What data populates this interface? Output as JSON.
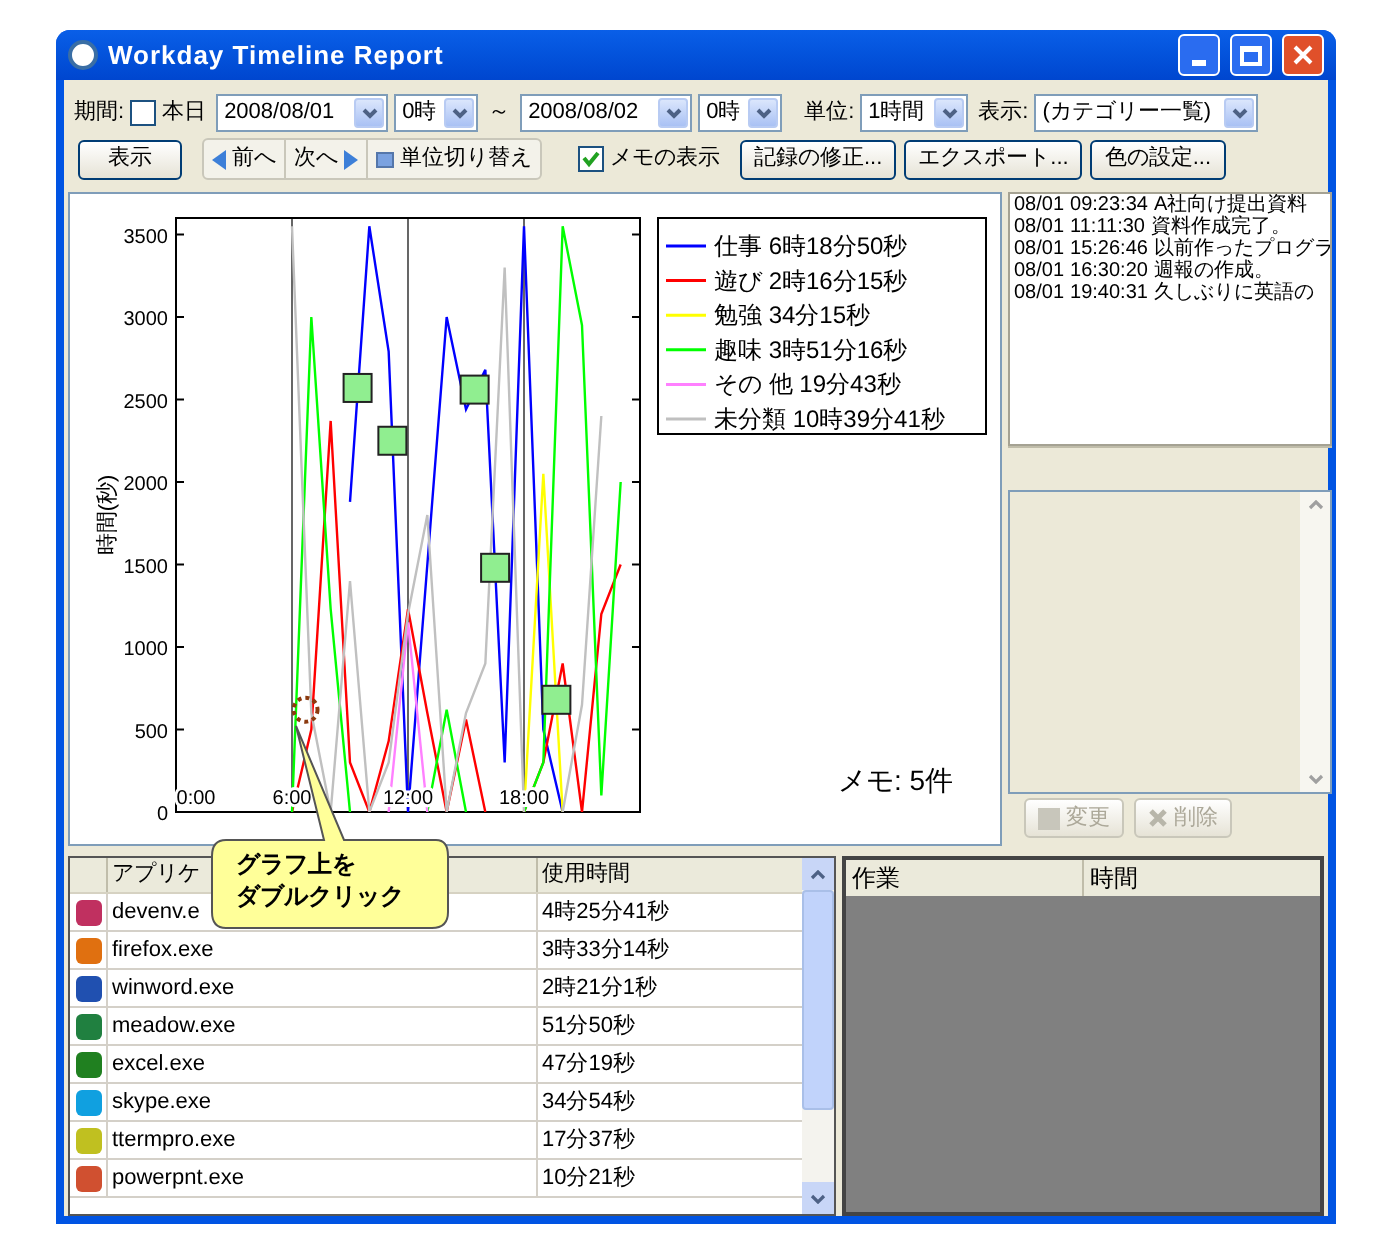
{
  "window": {
    "title": "Workday Timeline Report"
  },
  "toolbar": {
    "period_label": "期間:",
    "today": {
      "label": "本日",
      "checked": false
    },
    "start_date": "2008/08/01",
    "start_hour": "0時",
    "range_sep": "～",
    "end_date": "2008/08/02",
    "end_hour": "0時",
    "unit_label": "単位:",
    "unit": "1時間",
    "view_label": "表示:",
    "view": "(カテゴリー一覧)"
  },
  "actions": {
    "show": "表示",
    "prev": "前へ",
    "next": "次へ",
    "switch_unit": "単位切り替え",
    "memo_toggle": {
      "label": "メモの表示",
      "checked": true
    },
    "buttons": [
      "記録の修正...",
      "エクスポート...",
      "色の設定..."
    ]
  },
  "chart": {
    "memo_count": "メモ: 5件",
    "callout": [
      "グラフ上を",
      "ダブルクリック"
    ],
    "chart_data": {
      "type": "line",
      "ylabel": "時間(秒)",
      "grid": "x",
      "legend": true,
      "x": [
        6,
        7,
        8,
        9,
        10,
        11,
        12,
        13,
        14,
        15,
        16,
        17,
        18,
        19,
        20,
        21,
        22,
        23
      ],
      "xlim": [
        0,
        24
      ],
      "ylim": [
        0,
        3600
      ],
      "xticks": [
        {
          "value": 0,
          "label": "0:00"
        },
        {
          "value": 6,
          "label": "6:00"
        },
        {
          "value": 12,
          "label": "12:00"
        },
        {
          "value": 18,
          "label": "18:00"
        }
      ],
      "yticks": [
        0,
        500,
        1000,
        1500,
        2000,
        2500,
        3000,
        3500
      ],
      "series": [
        {
          "name": "仕事 6時18分50秒",
          "color": "#0000ff",
          "values": [
            null,
            null,
            null,
            1880,
            3550,
            2790,
            0,
            1500,
            3000,
            2440,
            2680,
            300,
            3550,
            500,
            0,
            null,
            null,
            null
          ]
        },
        {
          "name": "遊び 2時16分15秒",
          "color": "#ff0000",
          "values": [
            0,
            500,
            2370,
            300,
            0,
            430,
            1230,
            600,
            0,
            560,
            0,
            null,
            0,
            300,
            900,
            0,
            1200,
            1500
          ]
        },
        {
          "name": "勉強 34分15秒",
          "color": "#ffff00",
          "values": [
            null,
            null,
            null,
            null,
            null,
            null,
            null,
            null,
            null,
            null,
            null,
            null,
            0,
            2050,
            0,
            null,
            null,
            null
          ]
        },
        {
          "name": "趣味 3時51分16秒",
          "color": "#00ff00",
          "values": [
            0,
            3000,
            1230,
            0,
            null,
            null,
            null,
            0,
            620,
            0,
            null,
            null,
            0,
            300,
            3550,
            2950,
            100,
            2000
          ]
        },
        {
          "name": "その 他 19分43秒",
          "color": "#ff80ff",
          "values": [
            null,
            null,
            null,
            null,
            null,
            0,
            1150,
            0,
            null,
            null,
            null,
            null,
            null,
            null,
            null,
            null,
            null,
            null
          ]
        },
        {
          "name": "未分類 10時39分41秒",
          "color": "#c0c0c0",
          "values": [
            3550,
            600,
            0,
            1400,
            0,
            300,
            1200,
            1800,
            0,
            600,
            900,
            3300,
            0,
            null,
            0,
            650,
            2400,
            null
          ]
        }
      ]
    }
  },
  "memos": [
    {
      "date": "08/01",
      "time": "09:23:34",
      "text": "A社向け提出資料"
    },
    {
      "date": "08/01",
      "time": "11:11:30",
      "text": "資料作成完了。"
    },
    {
      "date": "08/01",
      "time": "15:26:46",
      "text": "以前作ったプログラ"
    },
    {
      "date": "08/01",
      "time": "16:30:20",
      "text": "週報の作成。"
    },
    {
      "date": "08/01",
      "time": "19:40:31",
      "text": "久しぶりに英語の"
    }
  ],
  "memo_buttons": [
    {
      "label": "変更",
      "kind": "edit",
      "disabled": true
    },
    {
      "label": "削除",
      "kind": "delete",
      "disabled": true
    }
  ],
  "app_table": {
    "columns": [
      "アプリケ",
      "使用時間"
    ],
    "rows": [
      {
        "app": "devenv.e",
        "time": "4時25分41秒",
        "color": "#c03060"
      },
      {
        "app": "firefox.exe",
        "time": "3時33分14秒",
        "color": "#e07010"
      },
      {
        "app": "winword.exe",
        "time": "2時21分1秒",
        "color": "#2050b0"
      },
      {
        "app": "meadow.exe",
        "time": "51分50秒",
        "color": "#208040"
      },
      {
        "app": "excel.exe",
        "time": "47分19秒",
        "color": "#208020"
      },
      {
        "app": "skype.exe",
        "time": "34分54秒",
        "color": "#10a0e0"
      },
      {
        "app": "ttermpro.exe",
        "time": "17分37秒",
        "color": "#c0c020"
      },
      {
        "app": "powerpnt.exe",
        "time": "10分21秒",
        "color": "#d05030"
      }
    ]
  },
  "task_table": {
    "columns": [
      "作業",
      "時間"
    ]
  }
}
